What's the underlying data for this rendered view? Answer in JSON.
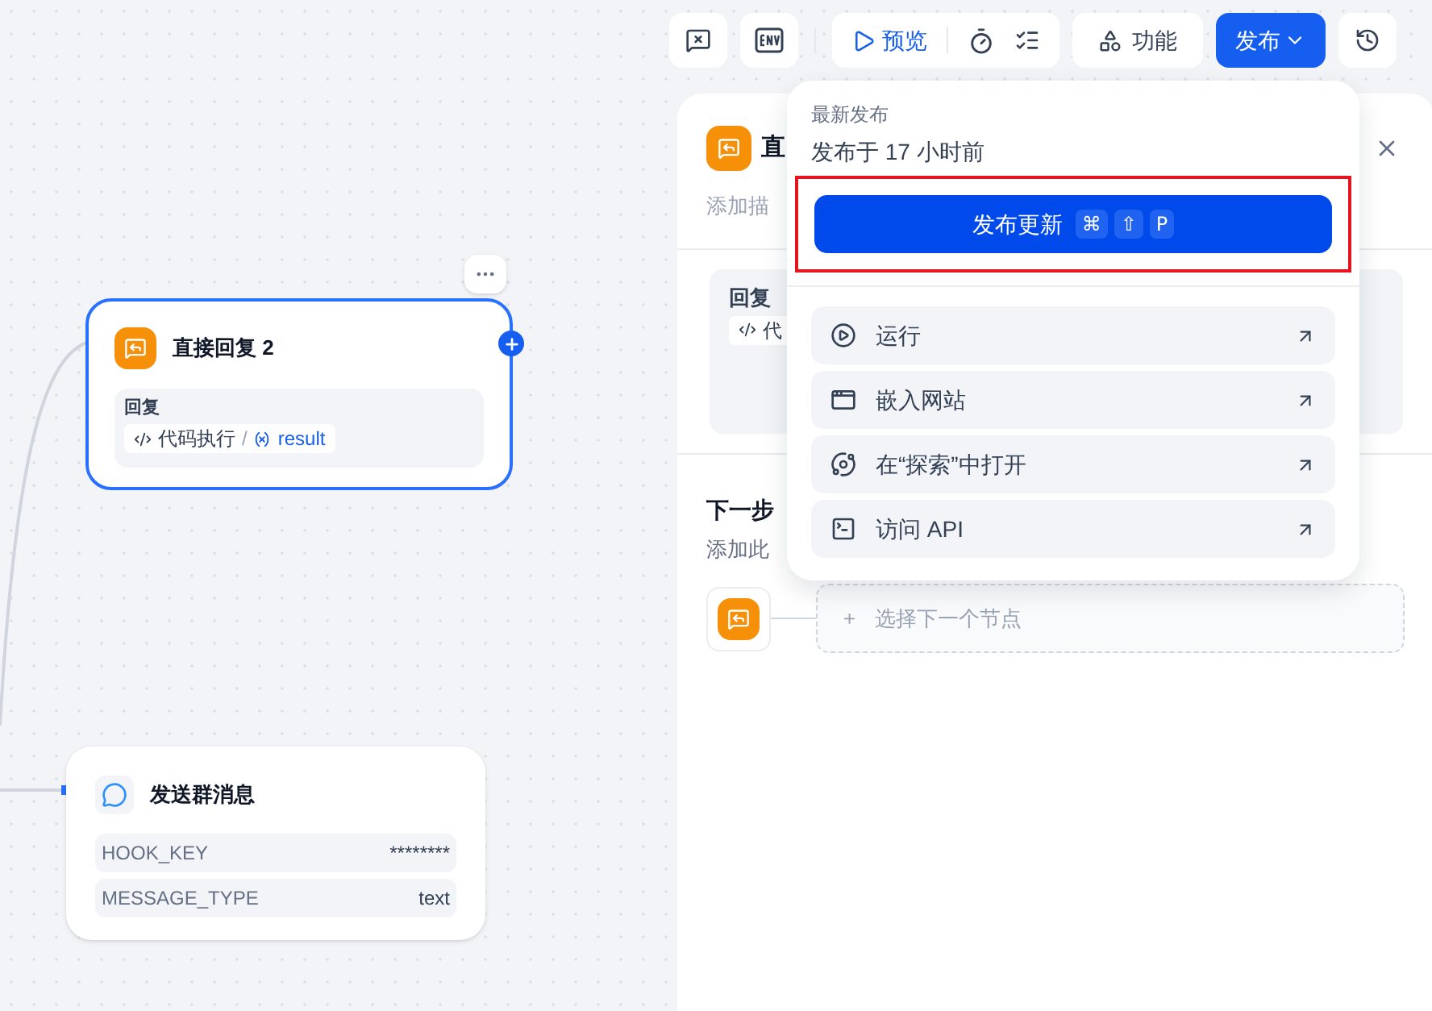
{
  "toolbar": {
    "preview": "预览",
    "features": "功能",
    "publish": "发布"
  },
  "nodes": [
    {
      "kind": "reply",
      "title": "直接回复 2",
      "selected": true,
      "field_label": "回复",
      "source": "代码执行",
      "separator": "/",
      "variable": "result"
    },
    {
      "kind": "message",
      "title": "发送群消息",
      "selected": false,
      "params": [
        {
          "name": "HOOK_KEY",
          "value": "********"
        },
        {
          "name": "MESSAGE_TYPE",
          "value": "text"
        }
      ]
    }
  ],
  "panel": {
    "title": "直",
    "description": "添加描",
    "reply_label": "回复",
    "reply_chip": "代",
    "next_title": "下一步",
    "next_description": "添加此",
    "next_placeholder": "选择下一个节点",
    "add_symbol": "+"
  },
  "publish_menu": {
    "heading": "最新发布",
    "published": "发布于 17 小时前",
    "update_button": "发布更新",
    "shortcut_keys": [
      "⌘",
      "⇧",
      "P"
    ],
    "highlighted": true,
    "items": [
      {
        "kind": "run",
        "label": "运行"
      },
      {
        "kind": "embed",
        "label": "嵌入网站"
      },
      {
        "kind": "explore",
        "label": "在“探索”中打开"
      },
      {
        "kind": "api",
        "label": "访问 API"
      }
    ]
  }
}
